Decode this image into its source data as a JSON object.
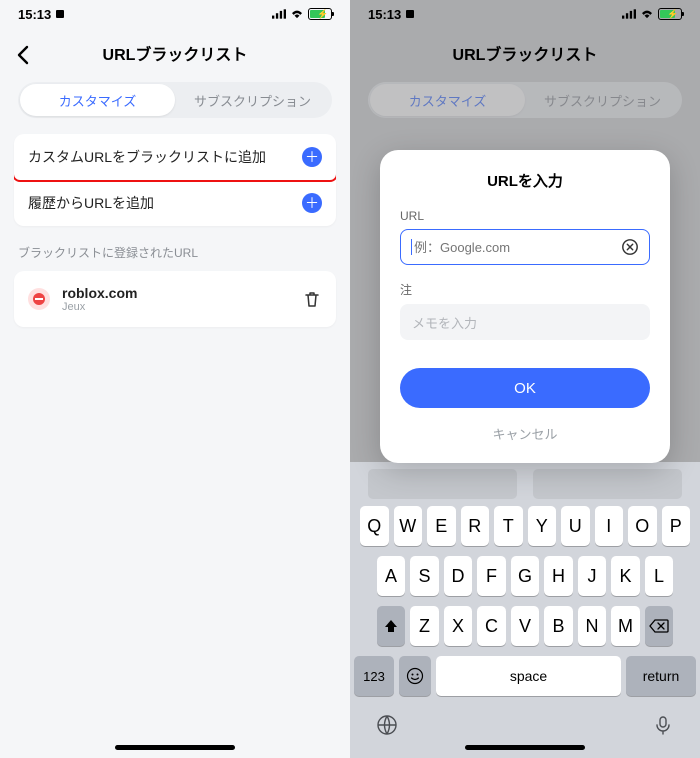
{
  "status": {
    "time": "15:13"
  },
  "header": {
    "title": "URLブラックリスト"
  },
  "tabs": {
    "active": "カスタマイズ",
    "inactive": "サブスクリプション"
  },
  "rows": {
    "add_custom": "カスタムURLをブラックリストに追加",
    "add_history": "履歴からURLを追加"
  },
  "section_label": "ブラックリストに登録されたURL",
  "item": {
    "name": "roblox.com",
    "sub": "Jeux"
  },
  "modal": {
    "title": "URLを入力",
    "url_label": "URL",
    "url_placeholder": "例：Google.com",
    "note_label": "注",
    "note_placeholder": "メモを入力",
    "ok": "OK",
    "cancel": "キャンセル"
  },
  "keyboard": {
    "row1": [
      "Q",
      "W",
      "E",
      "R",
      "T",
      "Y",
      "U",
      "I",
      "O",
      "P"
    ],
    "row2": [
      "A",
      "S",
      "D",
      "F",
      "G",
      "H",
      "J",
      "K",
      "L"
    ],
    "row3": [
      "Z",
      "X",
      "C",
      "V",
      "B",
      "N",
      "M"
    ],
    "num": "123",
    "space": "space",
    "return": "return"
  }
}
